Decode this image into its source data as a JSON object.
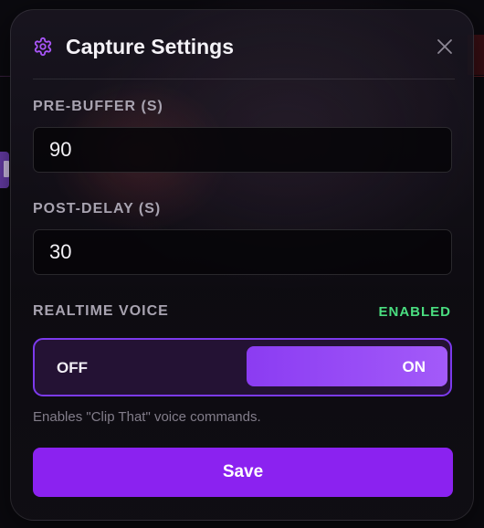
{
  "modal": {
    "title": "Capture Settings",
    "icon": "gear-icon",
    "close_icon": "close-icon"
  },
  "fields": {
    "pre_buffer": {
      "label": "PRE-BUFFER (S)",
      "value": "90"
    },
    "post_delay": {
      "label": "POST-DELAY (S)",
      "value": "30"
    }
  },
  "voice": {
    "label": "REALTIME VOICE",
    "status": "ENABLED",
    "status_color": "#4ade80",
    "toggle": {
      "off_label": "OFF",
      "on_label": "ON",
      "selected": "ON"
    },
    "helper": "Enables \"Clip That\" voice commands."
  },
  "actions": {
    "save_label": "Save"
  },
  "colors": {
    "accent": "#8b22f0",
    "toggle_border": "#7c3aed",
    "icon_purple": "#a855f7",
    "status_green": "#4ade80"
  }
}
